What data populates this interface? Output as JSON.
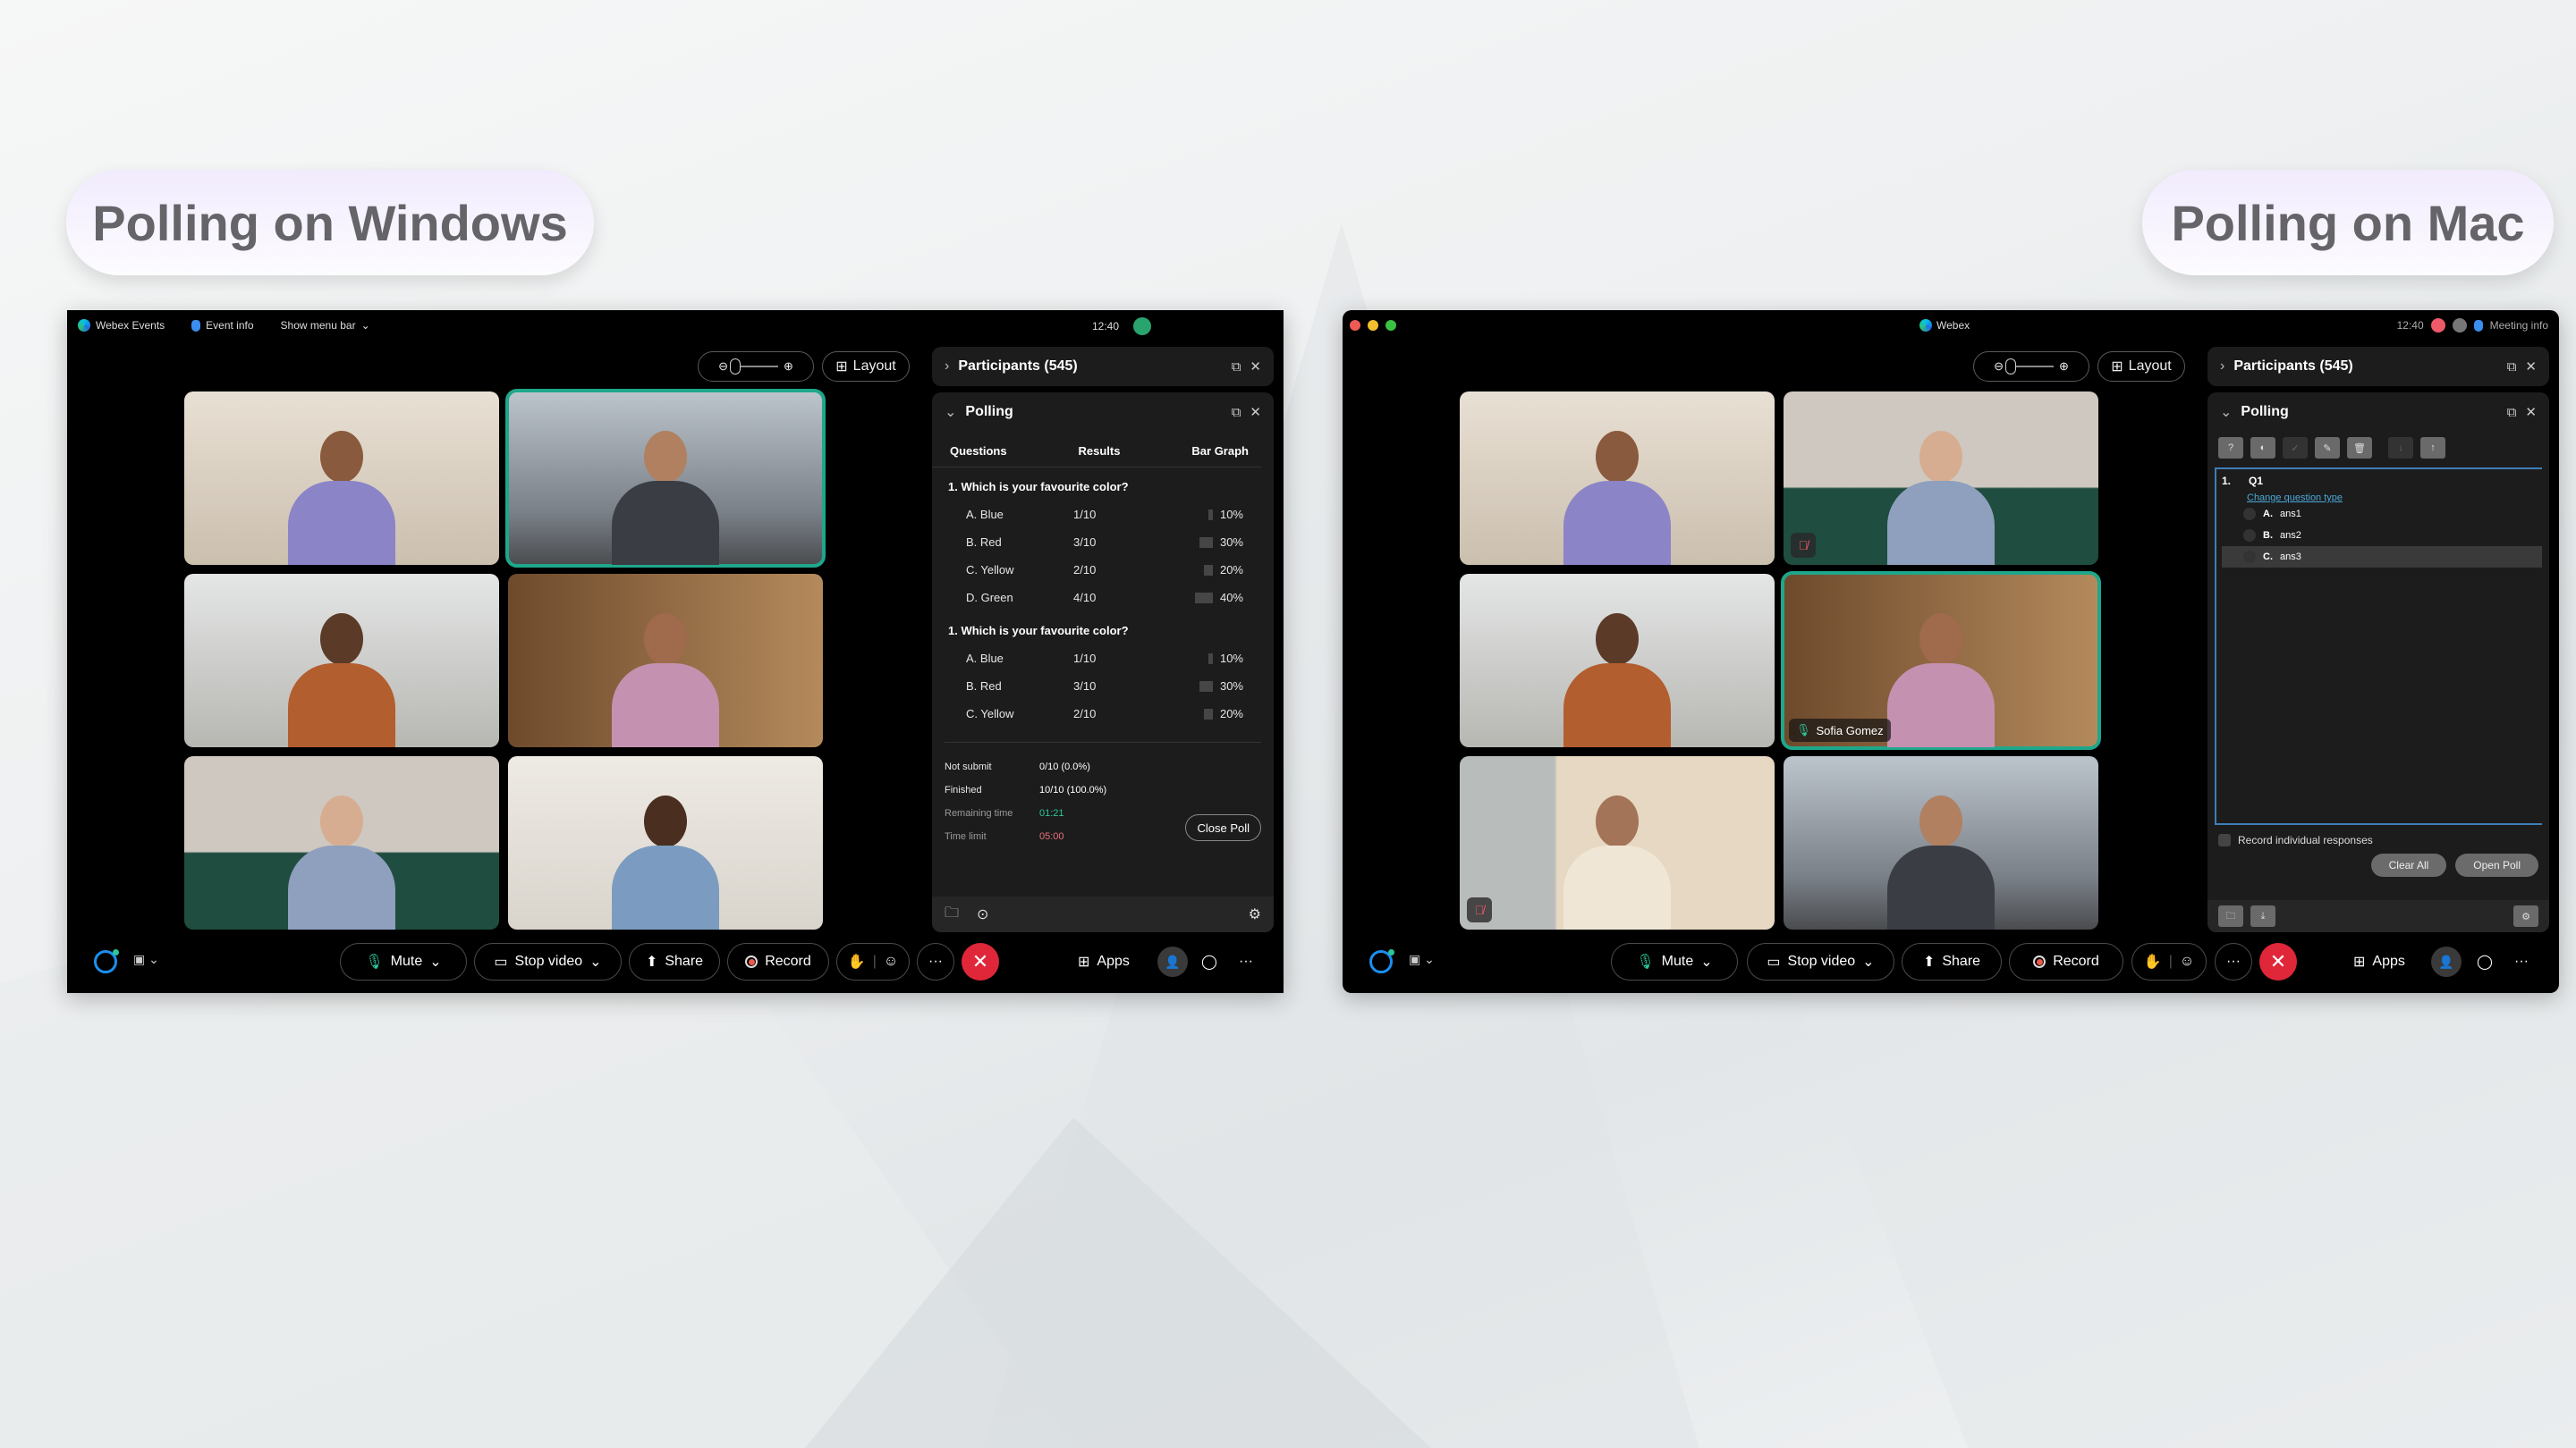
{
  "labels": {
    "windows": "Polling on Windows",
    "mac": "Polling on Mac"
  },
  "colors": {
    "accent_green": "#2cc69a",
    "active_border": "#1fa78b",
    "end_call_red": "#e0273a",
    "link_blue": "#4aa8d8",
    "time_limit_red": "#e8707d"
  },
  "windows": {
    "titlebar": {
      "app_name": "Webex Events",
      "event_info": "Event info",
      "show_menu_bar": "Show menu bar",
      "time": "12:40"
    },
    "layout_label": "Layout",
    "participants_label": "Participants (545)",
    "polling": {
      "title": "Polling",
      "headers": [
        "Questions",
        "Results",
        "Bar Graph"
      ],
      "questions": [
        {
          "text": "1. Which is your favourite color?",
          "options": [
            {
              "label": "A. Blue",
              "result": "1/10",
              "percent": "10%",
              "value": 10
            },
            {
              "label": "B. Red",
              "result": "3/10",
              "percent": "30%",
              "value": 30
            },
            {
              "label": "C. Yellow",
              "result": "2/10",
              "percent": "20%",
              "value": 20
            },
            {
              "label": "D. Green",
              "result": "4/10",
              "percent": "40%",
              "value": 40
            }
          ]
        },
        {
          "text": "1. Which is your favourite color?",
          "options": [
            {
              "label": "A. Blue",
              "result": "1/10",
              "percent": "10%",
              "value": 10
            },
            {
              "label": "B. Red",
              "result": "3/10",
              "percent": "30%",
              "value": 30
            },
            {
              "label": "C. Yellow",
              "result": "2/10",
              "percent": "20%",
              "value": 20
            }
          ]
        }
      ],
      "stats": {
        "not_submit_label": "Not submit",
        "not_submit_value": "0/10 (0.0%)",
        "finished_label": "Finished",
        "finished_value": "10/10 (100.0%)",
        "remaining_label": "Remaining time",
        "remaining_value": "01:21",
        "limit_label": "Time limit",
        "limit_value": "05:00"
      },
      "close_poll": "Close Poll"
    },
    "toolbar": {
      "mute": "Mute",
      "stop_video": "Stop video",
      "share": "Share",
      "record": "Record",
      "apps": "Apps"
    }
  },
  "mac": {
    "titlebar": {
      "app_name": "Webex",
      "time": "12:40",
      "meeting_info": "Meeting info"
    },
    "layout_label": "Layout",
    "participants_label": "Participants (545)",
    "active_speaker": "Sofia Gomez",
    "polling": {
      "title": "Polling",
      "question_number": "1.",
      "question": "Q1",
      "change_type": "Change question type",
      "answers": [
        {
          "letter": "A.",
          "text": "ans1"
        },
        {
          "letter": "B.",
          "text": "ans2"
        },
        {
          "letter": "C.",
          "text": "ans3"
        }
      ],
      "record_individual": "Record individual responses",
      "clear_all": "Clear All",
      "open_poll": "Open Poll"
    },
    "toolbar": {
      "mute": "Mute",
      "stop_video": "Stop video",
      "share": "Share",
      "record": "Record",
      "apps": "Apps"
    }
  }
}
